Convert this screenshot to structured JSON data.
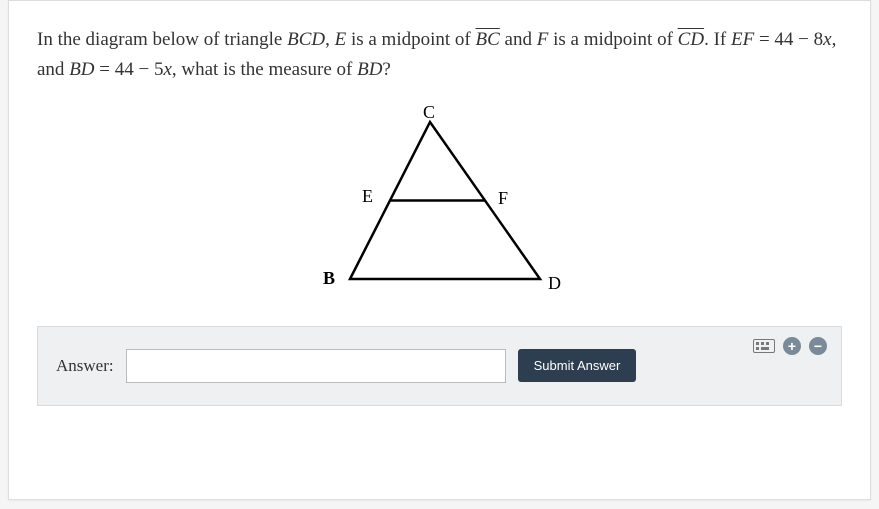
{
  "question": {
    "p1_a": "In the diagram below of triangle ",
    "tri": "BCD",
    "p1_b": ", ",
    "E": "E",
    "p1_c": " is a midpoint of ",
    "seg1": "BC",
    "p1_d": " and ",
    "F": "F",
    "p1_e": " is a midpoint of ",
    "seg2": "CD",
    "p1_f": ". If ",
    "EF": "EF",
    "eq": " = ",
    "expr1a": "44 − 8",
    "x1": "x",
    "p1_g": ", and ",
    "BD": "BD",
    "expr2a": "44 − 5",
    "x2": "x",
    "p1_h": ", what is the measure of ",
    "BD2": "BD",
    "qmark": "?"
  },
  "diagram": {
    "labels": {
      "B": "B",
      "C": "C",
      "D": "D",
      "E": "E",
      "F": "F"
    }
  },
  "answer": {
    "label": "Answer:",
    "value": "",
    "placeholder": ""
  },
  "submit_label": "Submit Answer"
}
